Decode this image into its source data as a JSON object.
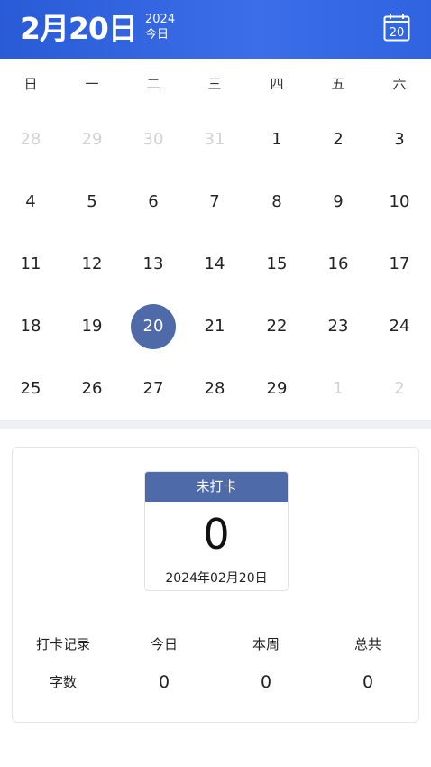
{
  "header": {
    "date": "2月20日",
    "year": "2024",
    "today_label": "今日",
    "calendar_icon_number": "20"
  },
  "weekdays": [
    "日",
    "一",
    "二",
    "三",
    "四",
    "五",
    "六"
  ],
  "calendar": {
    "weeks": [
      [
        {
          "d": "28",
          "muted": true
        },
        {
          "d": "29",
          "muted": true
        },
        {
          "d": "30",
          "muted": true
        },
        {
          "d": "31",
          "muted": true
        },
        {
          "d": "1"
        },
        {
          "d": "2"
        },
        {
          "d": "3"
        }
      ],
      [
        {
          "d": "4"
        },
        {
          "d": "5"
        },
        {
          "d": "6"
        },
        {
          "d": "7"
        },
        {
          "d": "8"
        },
        {
          "d": "9"
        },
        {
          "d": "10"
        }
      ],
      [
        {
          "d": "11"
        },
        {
          "d": "12"
        },
        {
          "d": "13"
        },
        {
          "d": "14"
        },
        {
          "d": "15"
        },
        {
          "d": "16"
        },
        {
          "d": "17"
        }
      ],
      [
        {
          "d": "18"
        },
        {
          "d": "19"
        },
        {
          "d": "20",
          "selected": true
        },
        {
          "d": "21"
        },
        {
          "d": "22"
        },
        {
          "d": "23"
        },
        {
          "d": "24"
        }
      ],
      [
        {
          "d": "25"
        },
        {
          "d": "26"
        },
        {
          "d": "27"
        },
        {
          "d": "28"
        },
        {
          "d": "29"
        },
        {
          "d": "1",
          "muted": true
        },
        {
          "d": "2",
          "muted": true
        }
      ]
    ]
  },
  "checkin": {
    "status": "未打卡",
    "count": "0",
    "date": "2024年02月20日"
  },
  "stats": {
    "headers": [
      "打卡记录",
      "今日",
      "本周",
      "总共"
    ],
    "row_label": "字数",
    "values": [
      "0",
      "0",
      "0"
    ]
  },
  "colors": {
    "header_blue": "#2a5bd7",
    "accent": "#4f6aa8",
    "muted_text": "#d2d2d2"
  }
}
